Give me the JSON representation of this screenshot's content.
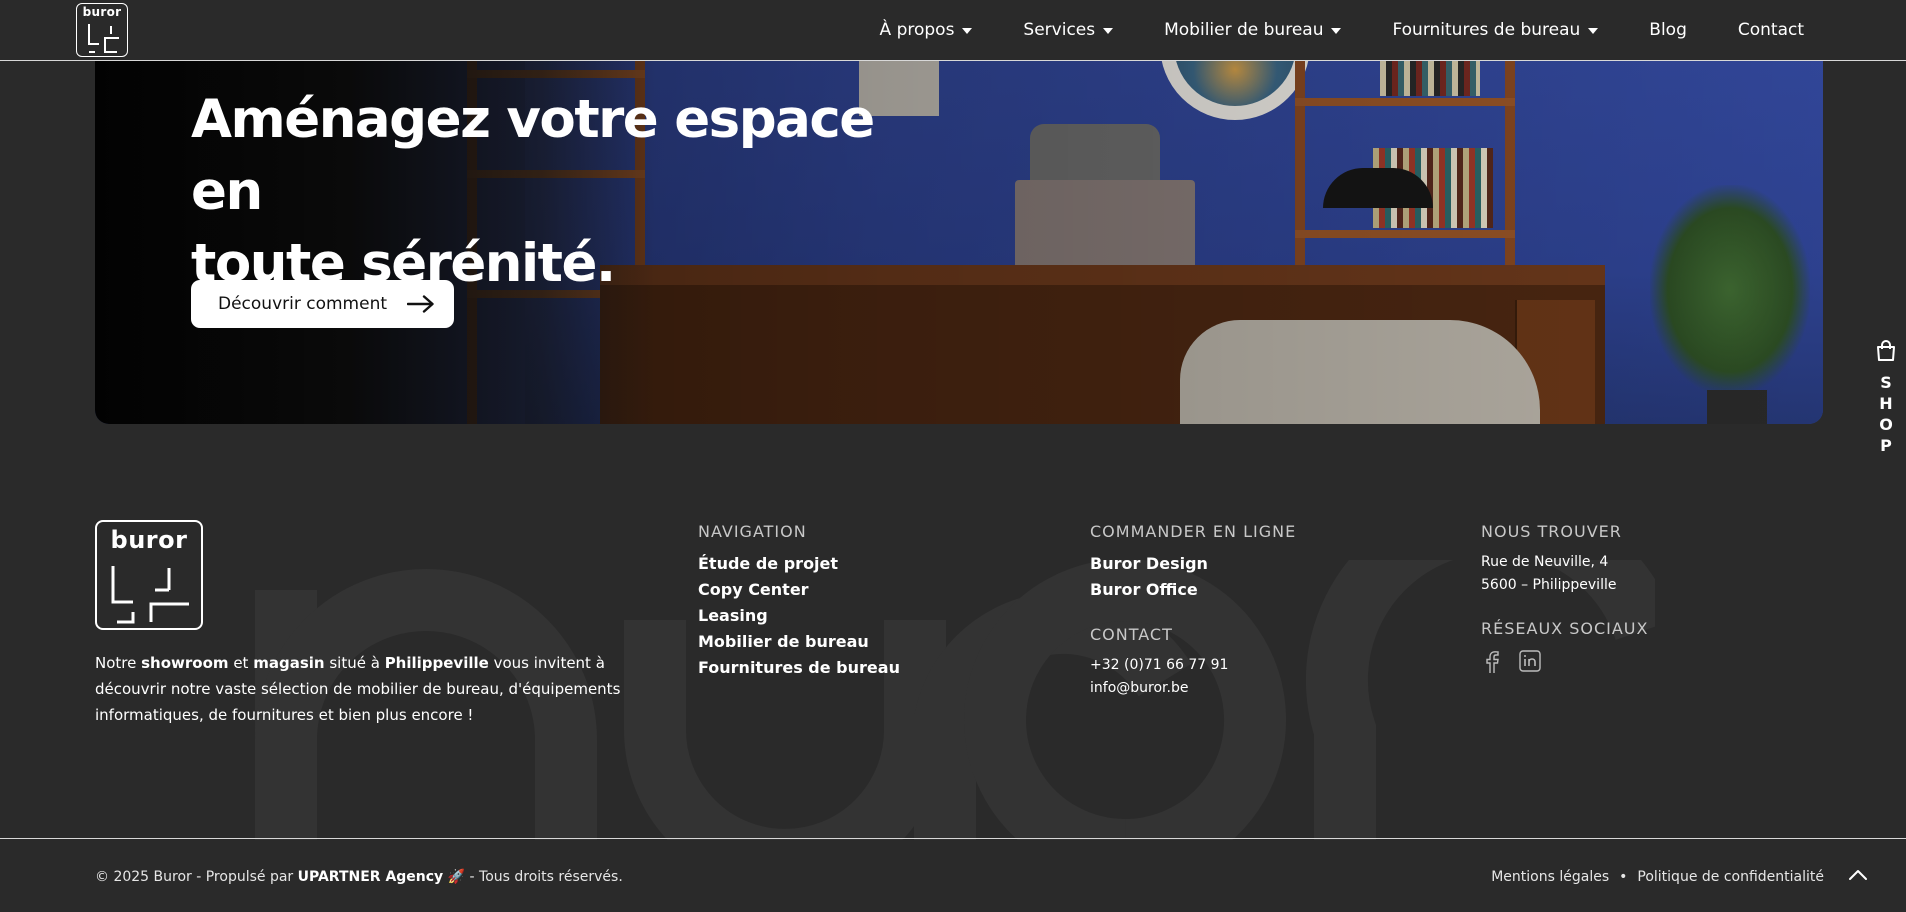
{
  "header": {
    "logo_text": "buror",
    "nav": [
      {
        "label": "À propos",
        "dropdown": true
      },
      {
        "label": "Services",
        "dropdown": true
      },
      {
        "label": "Mobilier de bureau",
        "dropdown": true
      },
      {
        "label": "Fournitures de bureau",
        "dropdown": true
      },
      {
        "label": "Blog",
        "dropdown": false
      },
      {
        "label": "Contact",
        "dropdown": false
      }
    ]
  },
  "hero": {
    "title_line1": "Aménagez votre espace en",
    "title_line2": "toute sérénité.",
    "button_label": "Découvrir comment"
  },
  "shop_tab": {
    "letters": [
      "S",
      "H",
      "O",
      "P"
    ]
  },
  "footer": {
    "logo_text": "buror",
    "about": {
      "p1": "Notre ",
      "b1": "showroom",
      "p2": " et ",
      "b2": "magasin",
      "p3": " situé à ",
      "b3": "Philippeville",
      "p4": " vous invitent à découvrir notre vaste sélection de mobilier de bureau, d'équipements informatiques, de fournitures et bien plus encore !"
    },
    "navigation": {
      "title": "NAVIGATION",
      "links": [
        "Étude de projet",
        "Copy Center",
        "Leasing",
        "Mobilier de bureau",
        "Fournitures de bureau"
      ]
    },
    "order_online": {
      "title": "COMMANDER EN LIGNE",
      "links": [
        "Buror Design",
        "Buror Office"
      ]
    },
    "contact": {
      "title": "CONTACT",
      "phone": "+32 (0)71 66 77 91",
      "email": "info@buror.be"
    },
    "find_us": {
      "title": "NOUS TROUVER",
      "address_line1": "Rue de Neuville, 4",
      "address_line2": "5600 – Philippeville"
    },
    "social": {
      "title": "RÉSEAUX SOCIAUX",
      "icons": [
        "facebook-icon",
        "linkedin-icon"
      ]
    },
    "watermark": "buror"
  },
  "bottom": {
    "copyright_prefix": "© 2025 Buror - Propulsé par ",
    "agency": "UPARTNER Agency",
    "agency_emoji": "🚀",
    "copyright_suffix": " - Tous droits réservés.",
    "legal_link": "Mentions légales",
    "separator": "•",
    "privacy_link": "Politique de confidentialité"
  }
}
